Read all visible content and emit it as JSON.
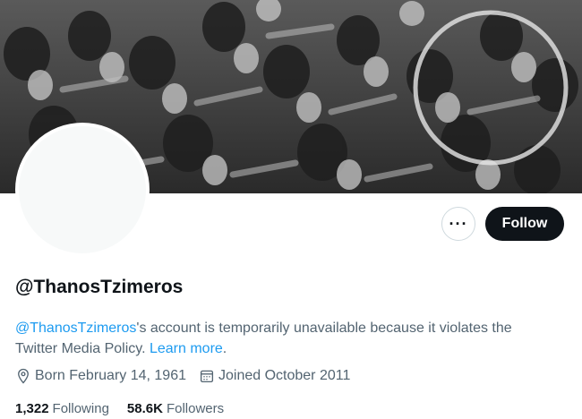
{
  "profile": {
    "handle": "@ThanosTzimeros",
    "notice": {
      "handle_link": "@ThanosTzimeros",
      "text": "'s account is temporarily unavailable because it violates the Twitter Media Policy. ",
      "learn_more": "Learn more",
      "end": "."
    },
    "born": "Born February 14, 1961",
    "joined": "Joined October 2011",
    "following_count": "1,322",
    "following_label": "Following",
    "followers_count": "58.6K",
    "followers_label": "Followers"
  },
  "actions": {
    "more_label": "···",
    "follow_label": "Follow"
  },
  "icons": {
    "more": "more-icon",
    "location": "location-pin-icon",
    "calendar": "calendar-icon"
  },
  "colors": {
    "accent": "#1d9bf0",
    "text_primary": "#0f1419",
    "text_secondary": "#536471",
    "follow_bg": "#0f1419"
  }
}
